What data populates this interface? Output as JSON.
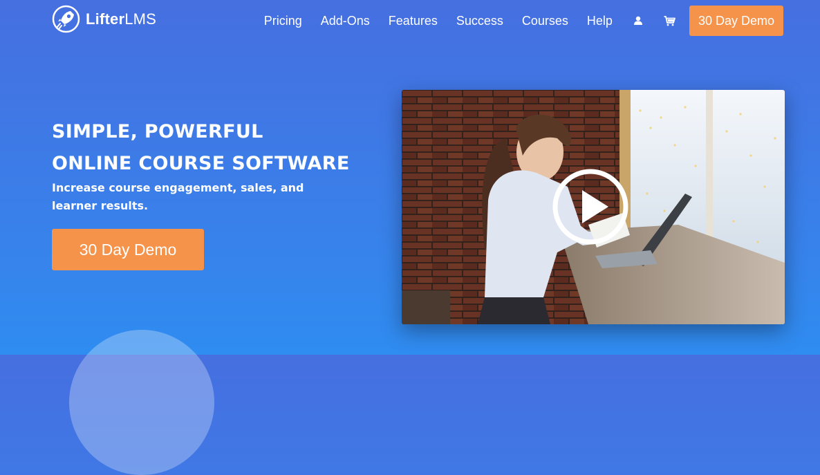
{
  "brand": {
    "name_bold": "Lifter",
    "name_light": "LMS",
    "logo_icon": "rocket-logo-icon"
  },
  "nav": {
    "links": [
      "Pricing",
      "Add-Ons",
      "Features",
      "Success",
      "Courses",
      "Help"
    ],
    "account_icon": "user-icon",
    "cart_icon": "cart-icon",
    "demo_label": "30 Day Demo"
  },
  "hero": {
    "title_line1": "SIMPLE, POWERFUL",
    "title_line2": "ONLINE COURSE SOFTWARE",
    "subtitle": "Increase course engagement, sales, and learner results.",
    "cta_label": "30 Day Demo"
  },
  "video": {
    "play_icon": "play-icon"
  },
  "colors": {
    "accent": "#f5934a",
    "background_top": "#466fe0",
    "background_bottom": "#2f8cf0"
  }
}
